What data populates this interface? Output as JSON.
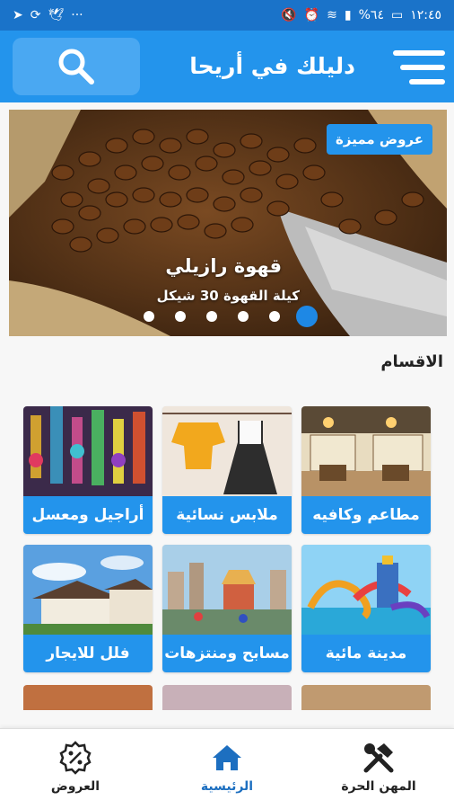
{
  "status_bar": {
    "time": "١٢:٤٥",
    "battery": "%٦٤"
  },
  "header": {
    "title": "دليلك في أريحا"
  },
  "banner": {
    "badge": "عروض مميزة",
    "title": "قهوة رازيلي",
    "subtitle": "كيلة القهوة 30 شيكل",
    "slide_count": 6,
    "active_slide_index": 0
  },
  "categories": {
    "title": "الاقسام",
    "items": [
      {
        "label": "مطاعم وكافيه"
      },
      {
        "label": "ملابس نسائية"
      },
      {
        "label": "أراجيل ومعسل"
      },
      {
        "label": "مدينة مائية"
      },
      {
        "label": "مسابح ومنتزهات"
      },
      {
        "label": "فلل للايجار"
      }
    ]
  },
  "bottom_nav": {
    "items": [
      {
        "label": "المهن الحرة",
        "icon": "tools-icon"
      },
      {
        "label": "الرئيسية",
        "icon": "home-icon"
      },
      {
        "label": "العروض",
        "icon": "discount-icon"
      }
    ],
    "active": "الرئيسية"
  },
  "colors": {
    "primary": "#2394ec",
    "status_bar": "#1a73c9",
    "active_nav": "#1d6fc0"
  }
}
